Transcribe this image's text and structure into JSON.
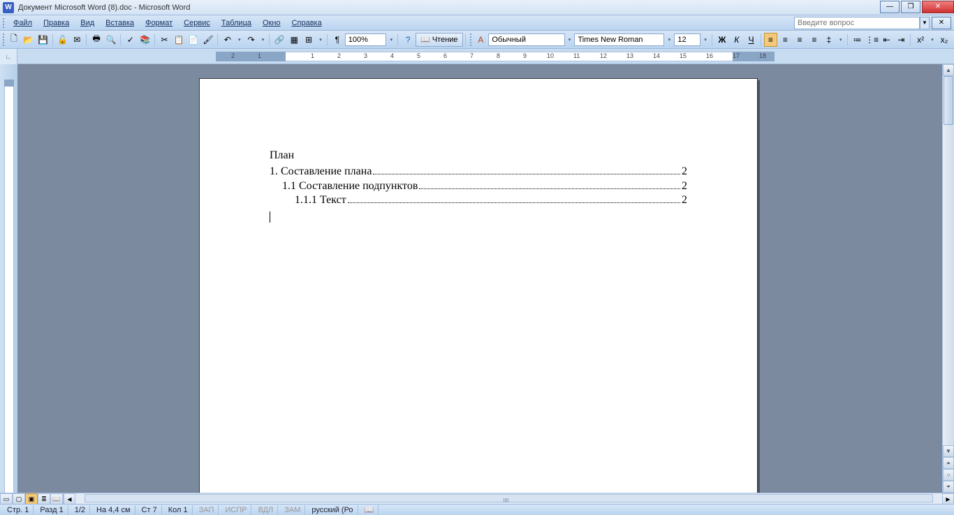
{
  "window": {
    "title": "Документ Microsoft Word (8).doc - Microsoft Word"
  },
  "menu": {
    "items": [
      "Файл",
      "Правка",
      "Вид",
      "Вставка",
      "Формат",
      "Сервис",
      "Таблица",
      "Окно",
      "Справка"
    ],
    "helpPlaceholder": "Введите вопрос"
  },
  "toolbar": {
    "zoom": "100%",
    "reading": "Чтение",
    "style": "Обычный",
    "font": "Times New Roman",
    "fontSize": "12"
  },
  "document": {
    "heading": "План",
    "tocLines": [
      {
        "text": "1. Составление плана",
        "page": "2",
        "level": 1
      },
      {
        "text": "1.1 Составление подпунктов",
        "page": "2",
        "level": 2
      },
      {
        "text": "1.1.1 Текст",
        "page": "2",
        "level": 3
      }
    ]
  },
  "ruler": {
    "marks": [
      "2",
      "1",
      "1",
      "2",
      "3",
      "4",
      "5",
      "6",
      "7",
      "8",
      "9",
      "10",
      "11",
      "12",
      "13",
      "14",
      "15",
      "16",
      "17",
      "18"
    ]
  },
  "status": {
    "page": "Стр. 1",
    "section": "Разд 1",
    "pages": "1/2",
    "at": "На 4,4 см",
    "line": "Ст 7",
    "col": "Кол 1",
    "rec": "ЗАП",
    "trk": "ИСПР",
    "ext": "ВДЛ",
    "ovr": "ЗАМ",
    "lang": "русский (Ро"
  }
}
